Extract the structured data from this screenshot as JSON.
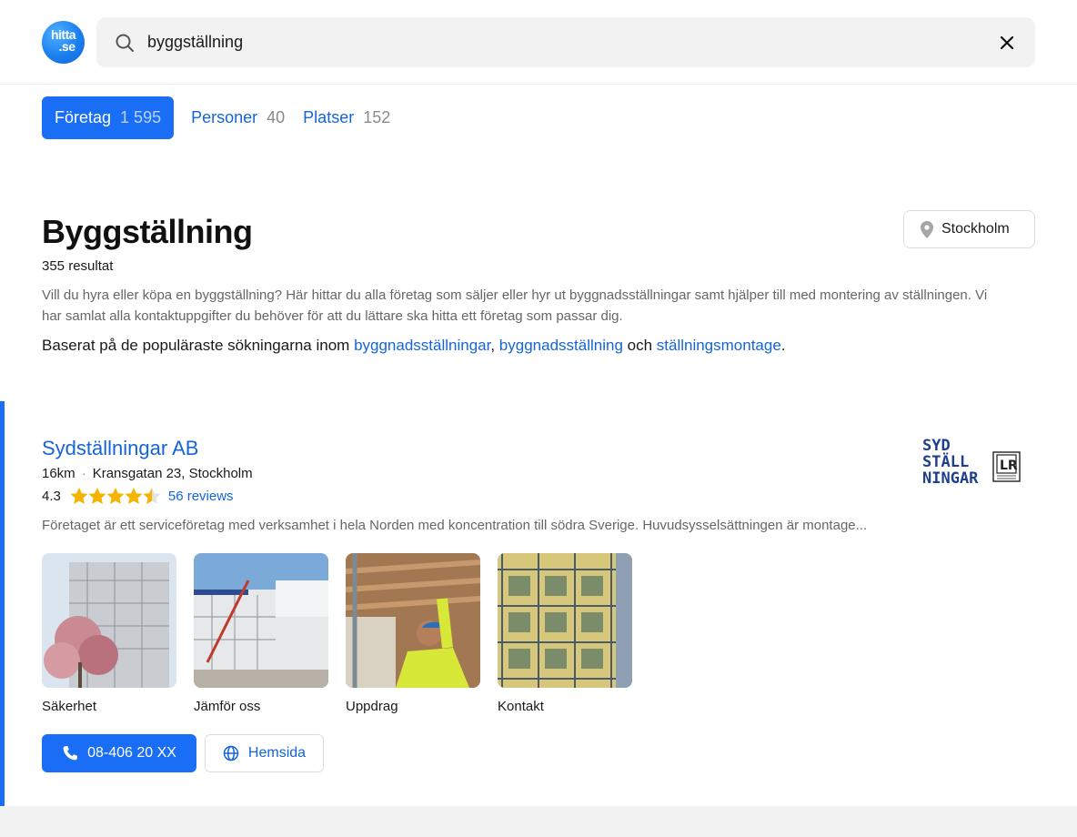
{
  "header": {
    "logo_line1": "hitta",
    "logo_line2": ".se",
    "search_value": "byggställning"
  },
  "tabs": [
    {
      "label": "Företag",
      "count": "1 595",
      "active": true
    },
    {
      "label": "Personer",
      "count": "40",
      "active": false
    },
    {
      "label": "Platser",
      "count": "152",
      "active": false
    }
  ],
  "main": {
    "title": "Byggställning",
    "result_count": "355 resultat",
    "location": "Stockholm",
    "description": "Vill du hyra eller köpa en byggställning? Här hittar du alla företag som säljer eller hyr ut byggnadsställningar samt hjälper till med montering av ställningen. Vi har samlat alla kontaktuppgifter du behöver för att du lättare ska hitta ett företag som passar dig.",
    "based_prefix": "Baserat på de populäraste sökningarna inom ",
    "based_links": [
      "byggnadsställningar",
      "byggnadsställning",
      "ställningsmontage"
    ],
    "based_sep1": ", ",
    "based_sep2": " och ",
    "based_suffix": "."
  },
  "result": {
    "name": "Sydställningar AB",
    "distance": "16km",
    "address": "Kransgatan 23, Stockholm",
    "rating": "4.3",
    "rating_value": 4.3,
    "reviews": "56 reviews",
    "logo_text": [
      "SYD",
      "STÄLL",
      "NINGAR"
    ],
    "logo_badge": "LR",
    "teaser": "Företaget är ett serviceföretag med verksamhet i hela Norden med koncentration till södra Sverige. Huvudsysselsättningen är montage...",
    "gallery": [
      "Säkerhet",
      "Jämför oss",
      "Uppdrag",
      "Kontakt"
    ],
    "phone": "08-406 20 XX",
    "website": "Hemsida"
  },
  "colors": {
    "accent": "#1a6ef5",
    "link": "#1565d8",
    "star": "#f5b400"
  }
}
